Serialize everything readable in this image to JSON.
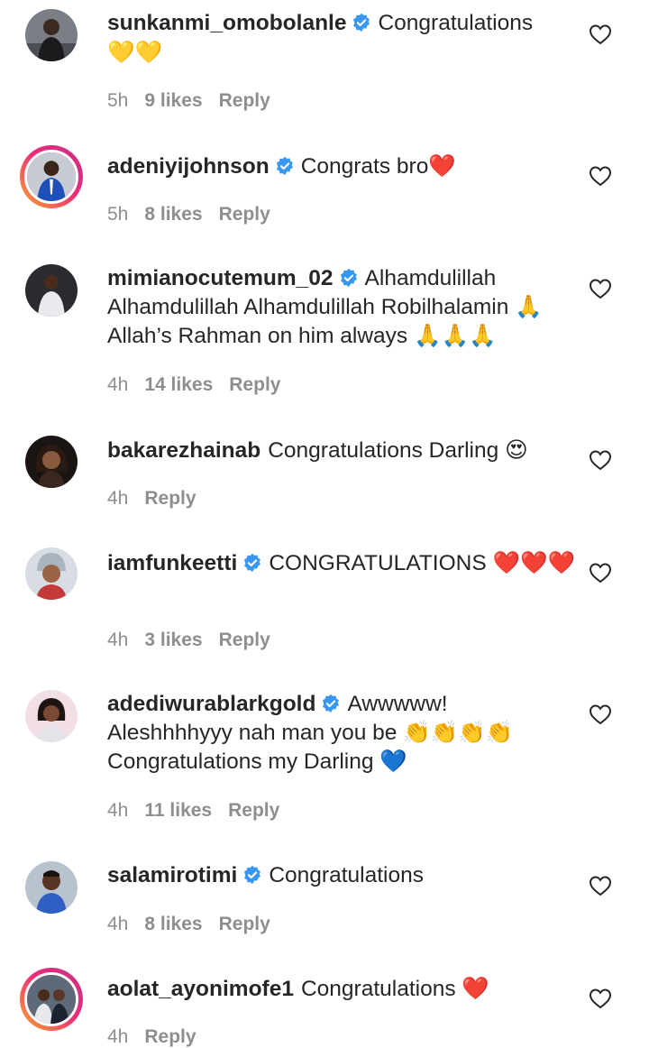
{
  "comments": [
    {
      "username": "sunkanmi_omobolanle",
      "verified": true,
      "text": "Congratulations",
      "emoji": "💛💛",
      "time": "5h",
      "likes": "9 likes",
      "reply": "Reply",
      "story_ring": false
    },
    {
      "username": "adeniyijohnson",
      "verified": true,
      "text": "Congrats bro",
      "emoji": "❤️",
      "time": "5h",
      "likes": "8 likes",
      "reply": "Reply",
      "story_ring": true
    },
    {
      "username": "mimianocutemum_02",
      "verified": true,
      "text": "Alhamdulillah Alhamdulillah Alhamdulillah Robilhalamin 🙏 Allah’s Rahman on him always 🙏🙏🙏",
      "emoji": "",
      "time": "4h",
      "likes": "14 likes",
      "reply": "Reply",
      "story_ring": false
    },
    {
      "username": "bakarezhainab",
      "verified": false,
      "text": "Congratulations Darling",
      "emoji": "😍",
      "time": "4h",
      "likes": "",
      "reply": "Reply",
      "story_ring": false
    },
    {
      "username": "iamfunkeetti",
      "verified": true,
      "text": "CONGRATULATIONS",
      "emoji": "❤️❤️❤️",
      "time": "4h",
      "likes": "3 likes",
      "reply": "Reply",
      "story_ring": false
    },
    {
      "username": "adediwurablarkgold",
      "verified": true,
      "text": "Awwwww! Aleshhhhyyy nah man you be 👏👏👏👏 Congratulations my Darling 💙",
      "emoji": "",
      "time": "4h",
      "likes": "11 likes",
      "reply": "Reply",
      "story_ring": false
    },
    {
      "username": "salamirotimi",
      "verified": true,
      "text": "Congratulations",
      "emoji": "",
      "time": "4h",
      "likes": "8 likes",
      "reply": "Reply",
      "story_ring": false
    },
    {
      "username": "aolat_ayonimofe1",
      "verified": false,
      "text": "Congratulations",
      "emoji": "❤️",
      "time": "4h",
      "likes": "",
      "reply": "Reply",
      "story_ring": true
    }
  ],
  "icons": {
    "verified_badge": "verified-badge-icon",
    "like": "heart-outline-icon"
  },
  "colors": {
    "verified_blue": "#3897f0",
    "meta_gray": "#8e8e8e",
    "text": "#262626"
  }
}
